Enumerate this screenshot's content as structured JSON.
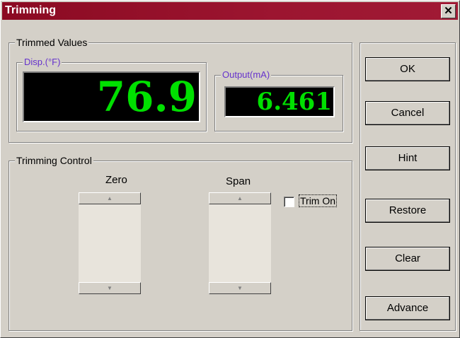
{
  "window": {
    "title": "Trimming",
    "close_glyph": "✕"
  },
  "trimmed_values": {
    "label": "Trimmed Values",
    "disp": {
      "label": "Disp.(°F)",
      "value": "76.9"
    },
    "output": {
      "label": "Output(mA)",
      "value": "6.461"
    }
  },
  "trimming_control": {
    "label": "Trimming Control",
    "zero_label": "Zero",
    "span_label": "Span",
    "trim_on_label": "Trim On",
    "trim_on_checked": false,
    "scroll_up_glyph": "▲",
    "scroll_down_glyph": "▼"
  },
  "buttons": {
    "ok": "OK",
    "cancel": "Cancel",
    "hint": "Hint",
    "restore": "Restore",
    "clear": "Clear",
    "advance": "Advance"
  },
  "colors": {
    "titlebar": "#9c1530",
    "lcd_background": "#000000",
    "lcd_digits": "#00e000",
    "sublabel": "#6633cc"
  }
}
